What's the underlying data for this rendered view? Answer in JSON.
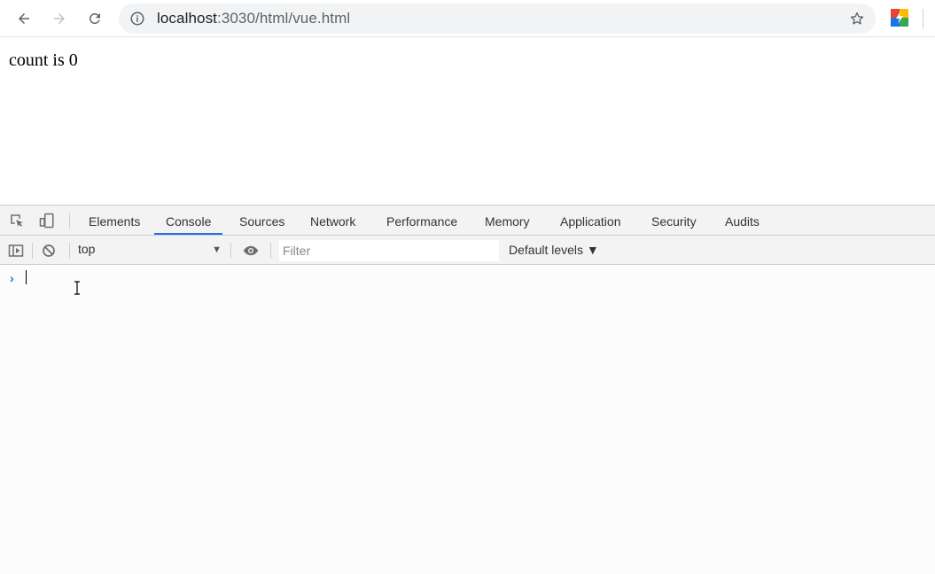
{
  "browser": {
    "url_host": "localhost",
    "url_rest": ":3030/html/vue.html"
  },
  "page": {
    "text": "count is 0"
  },
  "devtools": {
    "tabs": [
      {
        "label": "Elements"
      },
      {
        "label": "Console"
      },
      {
        "label": "Sources"
      },
      {
        "label": "Network"
      },
      {
        "label": "Performance"
      },
      {
        "label": "Memory"
      },
      {
        "label": "Application"
      },
      {
        "label": "Security"
      },
      {
        "label": "Audits"
      }
    ],
    "active_tab": "Console",
    "context": "top",
    "filter_placeholder": "Filter",
    "levels_label": "Default levels ▼",
    "prompt_symbol": "›"
  },
  "colors": {
    "accent": "#1a73e8"
  }
}
